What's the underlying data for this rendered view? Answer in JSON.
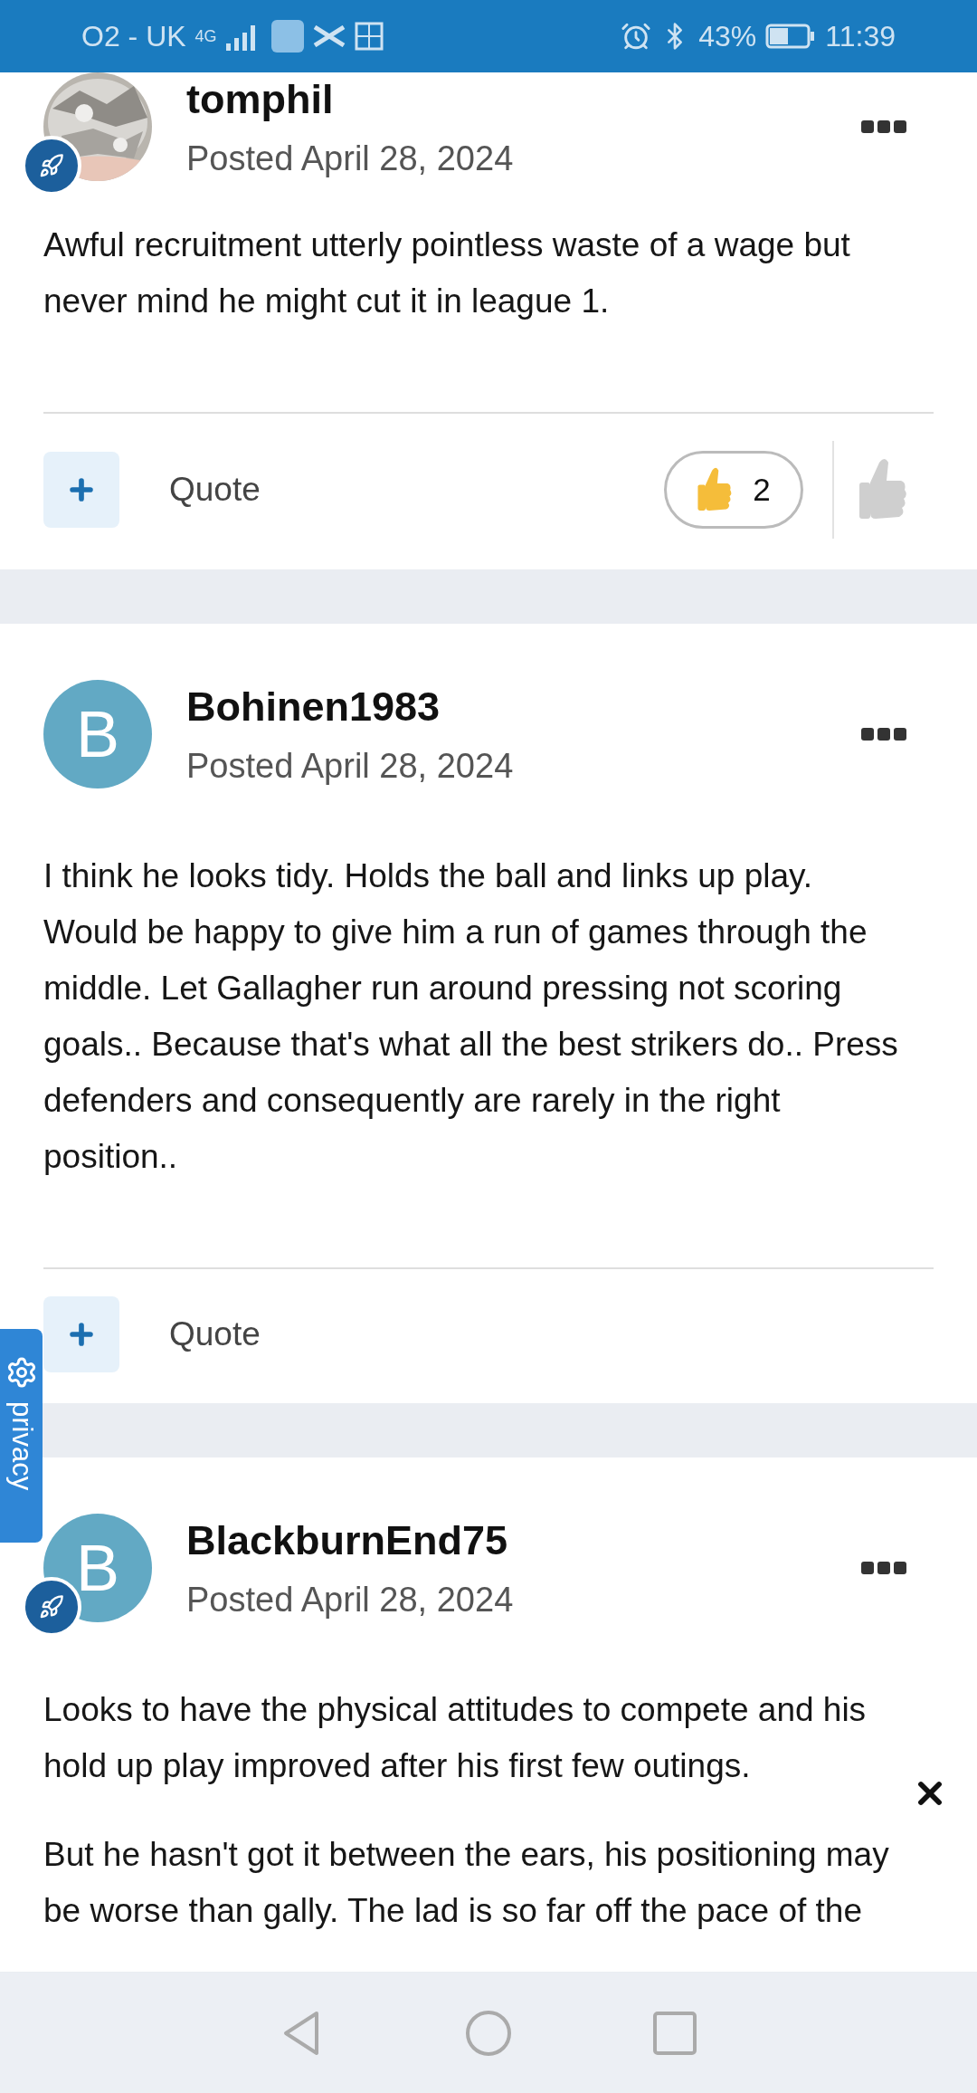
{
  "status_bar": {
    "carrier": "O2 - UK",
    "network": "4G",
    "battery": "43%",
    "time": "11:39"
  },
  "posts": [
    {
      "author": "tomphil",
      "avatar": {
        "kind": "picture"
      },
      "badge": true,
      "date": "Posted April 28, 2024",
      "paragraphs": [
        "Awful recruitment utterly pointless waste of a wage but never mind he might cut it in league 1."
      ],
      "quote": "Quote",
      "reactions": {
        "count": "2"
      }
    },
    {
      "author": "Bohinen1983",
      "avatar": {
        "kind": "letter",
        "letter": "B"
      },
      "badge": false,
      "date": "Posted April 28, 2024",
      "paragraphs": [
        "I think he looks tidy. Holds the ball and links up play. Would be happy to give him a run of games through the middle. Let Gallagher run around pressing not scoring goals.. Because that's what all the best strikers do.. Press defenders and consequently are rarely in the right position.."
      ],
      "quote": "Quote"
    },
    {
      "author": "BlackburnEnd75",
      "avatar": {
        "kind": "letter",
        "letter": "B"
      },
      "badge": true,
      "date": "Posted April 28, 2024",
      "paragraphs": [
        "Looks to have the physical attitudes to compete and his hold up play improved after his first few outings.",
        "But he hasn't got it between the ears, his positioning may be worse than gally. The lad is so far off the pace of the"
      ]
    }
  ],
  "privacy_tab": {
    "label": "privacy"
  }
}
